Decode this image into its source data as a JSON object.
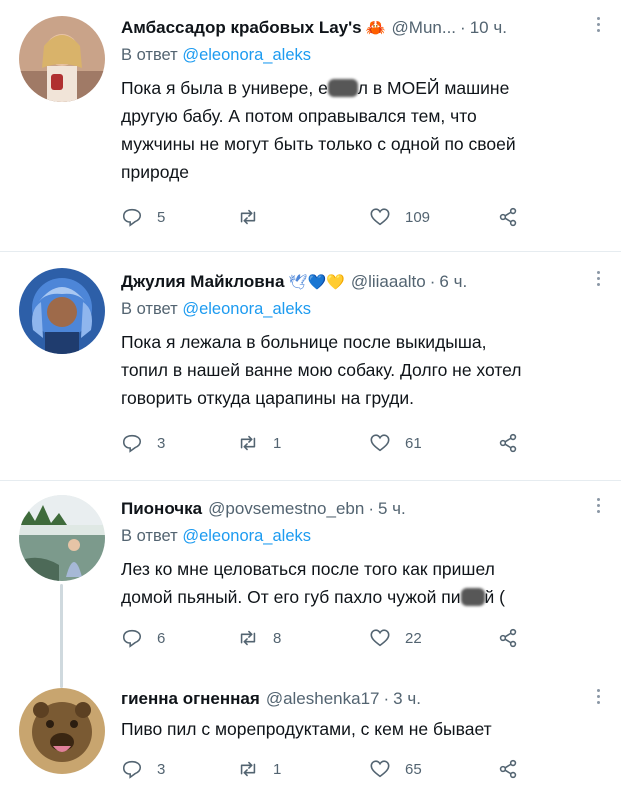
{
  "tweets": [
    {
      "name": "Амбассадор крабовых Lay's",
      "emoji": "🦀",
      "handle": "@Mun...",
      "time": "10 ч.",
      "reply_prefix": "В ответ",
      "reply_to": "@eleonora_aleks",
      "lines": [
        {
          "pre": "Пока я была в универе, е",
          "post": "л в МОЕЙ машине"
        },
        {
          "pre": "другую бабу. А потом оправывался тем, что"
        },
        {
          "pre": "мужчины не могут быть только с одной по своей"
        },
        {
          "pre": "природе"
        }
      ],
      "replies": "5",
      "retweets": "",
      "likes": "109"
    },
    {
      "name": "Джулия Майкловна",
      "emoji": "🕊💙💛",
      "handle": "@liiaaalto",
      "time": "6 ч.",
      "reply_prefix": "В ответ",
      "reply_to": "@eleonora_aleks",
      "lines": [
        {
          "pre": "Пока я лежала в больнице после выкидыша,"
        },
        {
          "pre": "топил в нашей ванне мою собаку. Долго не хотел"
        },
        {
          "pre": "говорить откуда царапины на груди."
        }
      ],
      "replies": "3",
      "retweets": "1",
      "likes": "61"
    },
    {
      "name": "Пионочка",
      "emoji": "",
      "handle": "@povsemestno_ebn",
      "time": "5 ч.",
      "reply_prefix": "В ответ",
      "reply_to": "@eleonora_aleks",
      "lines": [
        {
          "pre": "Лез ко мне целоваться после того как пришел"
        },
        {
          "pre": "домой пьяный. От его губ пахло чужой пи",
          "post": "й ("
        }
      ],
      "replies": "6",
      "retweets": "8",
      "likes": "22"
    },
    {
      "name": "гиенна огненная",
      "emoji": "",
      "handle": "@aleshenka17",
      "time": "3 ч.",
      "reply_prefix": "",
      "reply_to": "",
      "lines": [
        {
          "pre": "Пиво пил с морепродуктами, с кем не бывает"
        }
      ],
      "replies": "3",
      "retweets": "1",
      "likes": "65"
    }
  ],
  "colors": {
    "text": "#0f1419",
    "secondary": "#536471",
    "link": "#1d9bf0",
    "divider": "#e6ecf0"
  },
  "icons": [
    "reply-icon",
    "retweet-icon",
    "like-icon",
    "share-icon",
    "more-icon"
  ]
}
